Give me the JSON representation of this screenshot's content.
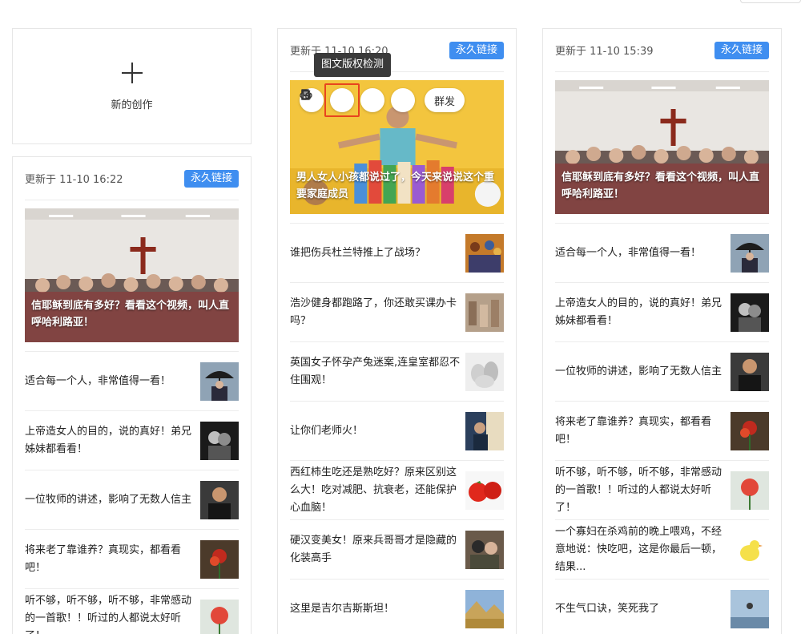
{
  "new_card": {
    "label": "新的创作"
  },
  "perm_link_label": "永久链接",
  "tooltip": "图文版权检测",
  "toolbar": {
    "mass_send_label": "群发"
  },
  "columns": [
    {
      "updated": "更新于 11-10 16:22",
      "cover_title": "信耶稣到底有多好？看看这个视频，叫人直呼哈利路亚！",
      "cover_image": "church-group-photo",
      "items": [
        {
          "title": "适合每一个人，非常值得一看！",
          "thumb": "umbrella"
        },
        {
          "title": "上帝造女人的目的，说的真好！弟兄姊妹都看看！",
          "thumb": "couple"
        },
        {
          "title": "一位牧师的讲述，影响了无数人信主",
          "thumb": "man"
        },
        {
          "title": "将来老了靠谁养？真现实，都看看吧！",
          "thumb": "flower"
        },
        {
          "title": "听不够，听不够，听不够，非常感动的一首歌！！听过的人都说太好听了！",
          "thumb": "rose"
        }
      ]
    },
    {
      "updated": "更新于 11-10 16:20",
      "cover_title": "男人女人小孩都说过了，今天来说说这个重要家庭成员",
      "cover_image": "man-with-pet-food",
      "items": [
        {
          "title": "谁把伤兵杜兰特推上了战场？",
          "thumb": "crowd"
        },
        {
          "title": "浩沙健身都跑路了，你还敢买课办卡吗？",
          "thumb": "gym"
        },
        {
          "title": "英国女子怀孕产兔迷案,连皇室都忍不住围观！",
          "thumb": "rabbit"
        },
        {
          "title": "让你们老师火！",
          "thumb": "teacher"
        },
        {
          "title": "西红柿生吃还是熟吃好？原来区别这么大！吃对减肥、抗衰老，还能保护心血脑！",
          "thumb": "tomato"
        },
        {
          "title": "硬汉变美女！原来兵哥哥才是隐藏的化装高手",
          "thumb": "soldier"
        },
        {
          "title": "这里是吉尔吉斯斯坦！",
          "thumb": "landscape"
        }
      ]
    },
    {
      "updated": "更新于 11-10 15:39",
      "cover_title": "信耶稣到底有多好？看看这个视频，叫人直呼哈利路亚！",
      "cover_image": "church-group-photo",
      "items": [
        {
          "title": "适合每一个人，非常值得一看！",
          "thumb": "umbrella"
        },
        {
          "title": "上帝造女人的目的，说的真好！弟兄姊妹都看看！",
          "thumb": "couple"
        },
        {
          "title": "一位牧师的讲述，影响了无数人信主",
          "thumb": "man"
        },
        {
          "title": "将来老了靠谁养？真现实，都看看吧！",
          "thumb": "flower"
        },
        {
          "title": "听不够，听不够，听不够，非常感动的一首歌！！听过的人都说太好听了！",
          "thumb": "rose"
        },
        {
          "title": "一个寡妇在杀鸡前的晚上喂鸡，不经意地说：快吃吧，这是你最后一顿，结果...",
          "thumb": "chick"
        },
        {
          "title": "不生气口诀，笑死我了",
          "thumb": "sky"
        }
      ]
    }
  ],
  "colors": {
    "accent": "#3f8ef0",
    "highlight": "#e8441e",
    "tooltip_bg": "#3a3a3a"
  }
}
